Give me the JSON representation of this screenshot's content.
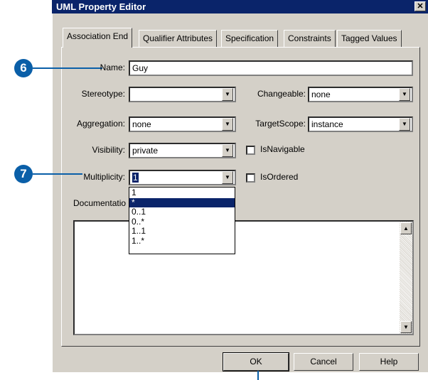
{
  "window": {
    "title": "UML Property Editor",
    "close_glyph": "✕"
  },
  "tabs": [
    {
      "label": "Association End"
    },
    {
      "label": "Qualifier Attributes"
    },
    {
      "label": "Specification"
    },
    {
      "label": "Constraints"
    },
    {
      "label": "Tagged Values"
    }
  ],
  "fields": {
    "name": {
      "label": "Name:",
      "value": "Guy"
    },
    "stereotype": {
      "label": "Stereotype:",
      "value": ""
    },
    "changeable": {
      "label": "Changeable:",
      "value": "none"
    },
    "aggregation": {
      "label": "Aggregation:",
      "value": "none"
    },
    "target_scope": {
      "label": "TargetScope:",
      "value": "instance"
    },
    "visibility": {
      "label": "Visibility:",
      "value": "private"
    },
    "multiplicity": {
      "label": "Multiplicity:",
      "value": "1"
    },
    "documentation": {
      "label": "Documentatio",
      "value": ""
    }
  },
  "checkboxes": {
    "is_navigable": {
      "label": "IsNavigable",
      "checked": false
    },
    "is_ordered": {
      "label": "IsOrdered",
      "checked": false
    }
  },
  "multiplicity_options": [
    "1",
    "*",
    "0..1",
    "0..*",
    "1..1",
    "1..*"
  ],
  "multiplicity_selected_index": 1,
  "buttons": {
    "ok": "OK",
    "cancel": "Cancel",
    "help": "Help"
  },
  "callouts": {
    "six": "6",
    "seven": "7"
  },
  "colors": {
    "titlebar": "#0a246a",
    "callout": "#0a5fa8",
    "dialog": "#d4d0c8"
  }
}
